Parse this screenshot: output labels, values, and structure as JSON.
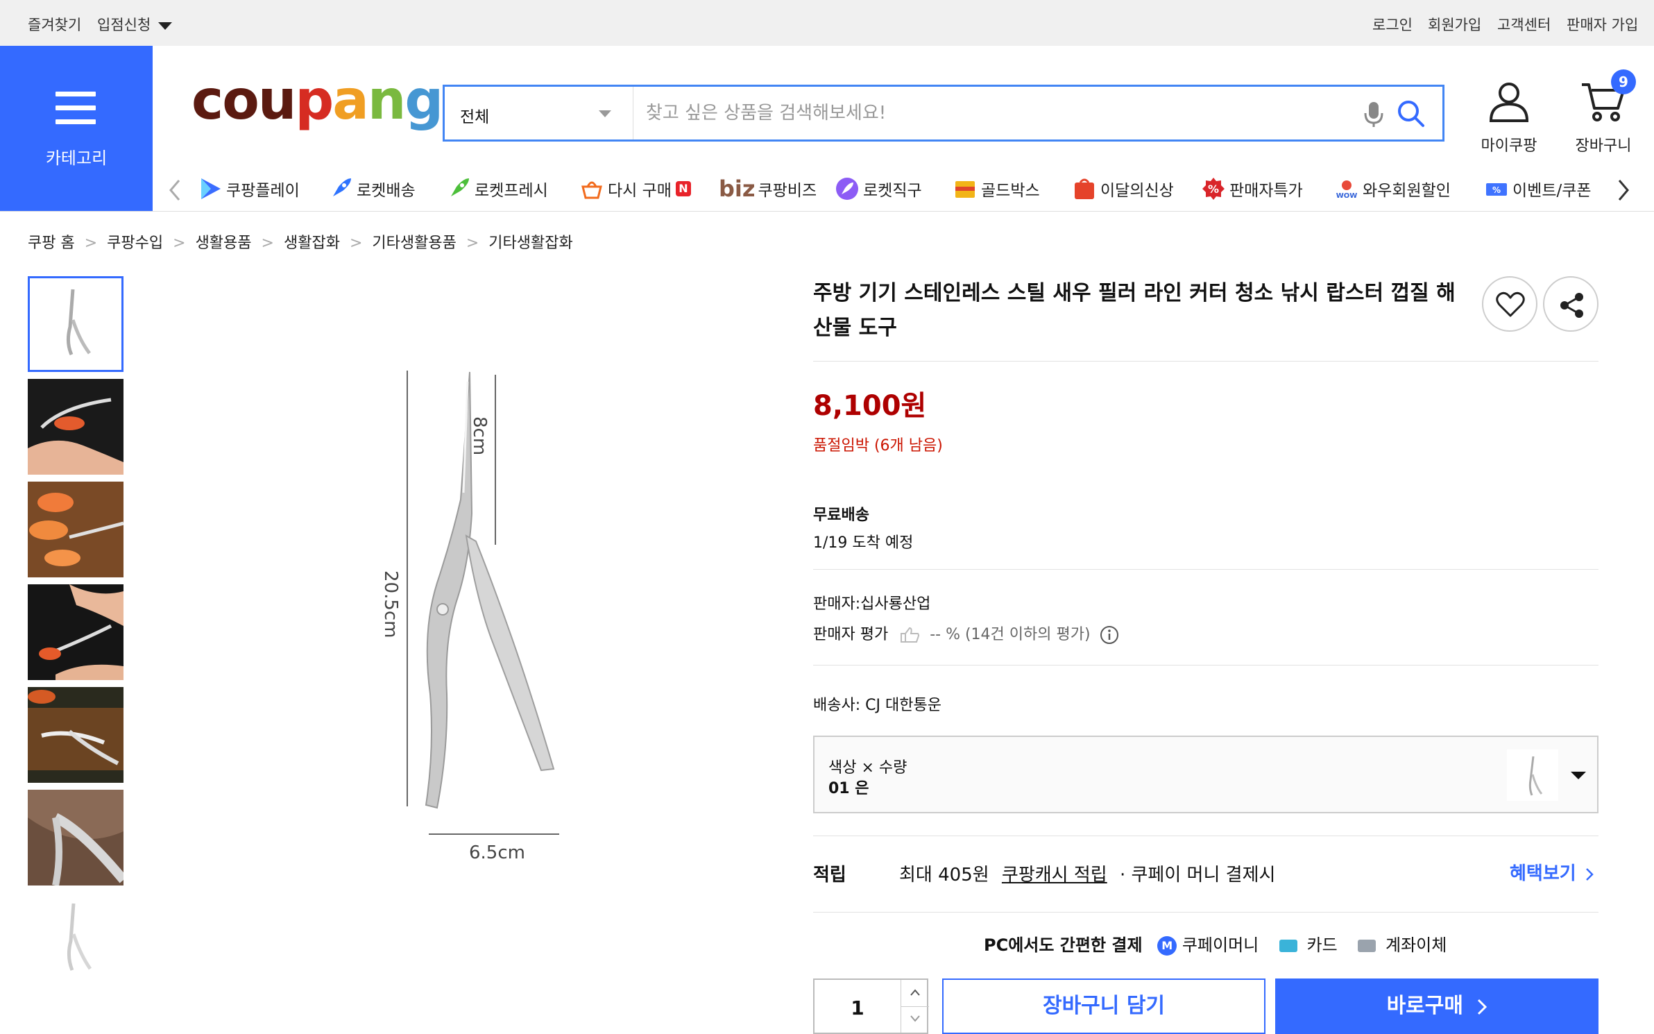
{
  "topbar": {
    "favorites": "즐겨찾기",
    "store_apply": "입점신청",
    "login": "로그인",
    "signup": "회원가입",
    "customer_center": "고객센터",
    "seller_signup": "판매자 가입"
  },
  "header": {
    "category_label": "카테고리",
    "logo_letters": [
      "c",
      "o",
      "u",
      "p",
      "a",
      "n",
      "g"
    ],
    "logo_colors": [
      "#5b1a10",
      "#5b1a10",
      "#5b1a10",
      "#d62c22",
      "#f09e23",
      "#7ab93f",
      "#4697d3"
    ],
    "search": {
      "category": "전체",
      "placeholder": "찾고 싶은 상품을 검색해보세요!"
    },
    "my_coupang": "마이쿠팡",
    "cart": "장바구니",
    "cart_count": "9"
  },
  "nav": {
    "items": [
      {
        "label": "쿠팡플레이",
        "icon": "play-icon"
      },
      {
        "label": "로켓배송",
        "icon": "rocket-icon"
      },
      {
        "label": "로켓프레시",
        "icon": "rocket-fresh-icon"
      },
      {
        "label": "다시 구매",
        "icon": "reorder-icon"
      },
      {
        "label": "쿠팡비즈",
        "icon": "biz-icon"
      },
      {
        "label": "로켓직구",
        "icon": "rocket-global-icon"
      },
      {
        "label": "골드박스",
        "icon": "goldbox-icon"
      },
      {
        "label": "이달의신상",
        "icon": "new-icon"
      },
      {
        "label": "판매자특가",
        "icon": "seller-deal-icon"
      },
      {
        "label": "와우회원할인",
        "icon": "wow-icon"
      },
      {
        "label": "이벤트/쿠폰",
        "icon": "coupon-icon"
      }
    ],
    "new_badge": "N",
    "biz_logo": "biz"
  },
  "breadcrumb": [
    "쿠팡 홈",
    "쿠팡수입",
    "생활용품",
    "생활잡화",
    "기타생활용품",
    "기타생활잡화"
  ],
  "product": {
    "title": "주방 기기 스테인레스 스틸 새우 필러 라인 커터 청소 낚시 랍스터 껍질 해산물 도구",
    "price": "8,100원",
    "stock_notice": "품절임박 (6개 남음)",
    "shipping_title": "무료배송",
    "arrival": "1/19 도착 예정",
    "seller": "판매자:십사룡산업",
    "seller_rating_label": "판매자 평가",
    "seller_rating_value": "-- % (14건 이하의 평가)",
    "courier": "배송사:  CJ 대한통운",
    "option_label": "색상 × 수량",
    "option_value": "01 은",
    "reward_label": "적립",
    "reward_max": "최대 405원",
    "reward_cash": "쿠팡캐시 적립",
    "reward_suffix": "· 쿠페이 머니 결제시",
    "benefit_link": "혜택보기",
    "pay_title": "PC에서도 간편한 결제",
    "pay_money": "쿠페이머니",
    "pay_card": "카드",
    "pay_bank": "계좌이체",
    "quantity": "1",
    "add_to_cart": "장바구니 담기",
    "buy_now": "바로구매",
    "image_dims": {
      "length": "20.5cm",
      "tip": "8cm",
      "width": "6.5cm"
    }
  }
}
